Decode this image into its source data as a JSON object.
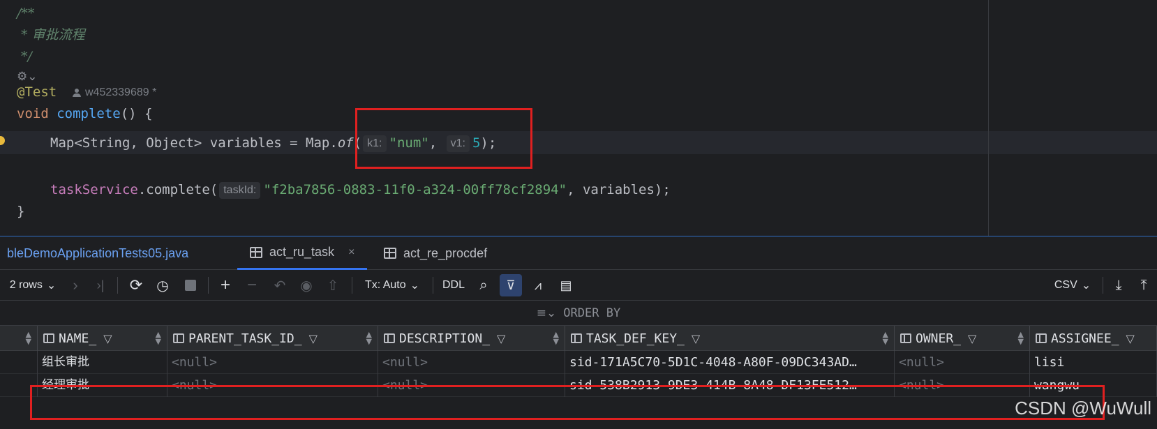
{
  "editor": {
    "comment_open": "/**",
    "comment_text": " * 审批流程",
    "comment_close": " */",
    "annotation": "@Test",
    "author": "w452339689 *",
    "method_kw": "void",
    "method_name": "complete",
    "method_tail": "() {",
    "line_map_prefix": "Map<String, Object> variables = Map.",
    "line_map_method": "of",
    "line_map_open": "(",
    "hint_k1": "k1:",
    "val_k1": "\"num\"",
    "comma": ", ",
    "hint_v1": "v1:",
    "val_v1": "5",
    "line_map_close": ");",
    "service_field": "taskService",
    "service_call": ".complete(",
    "hint_taskid": "taskId:",
    "task_id": "\"f2ba7856-0883-11f0-a324-00ff78cf2894\"",
    "service_tail": ", variables);",
    "close_brace": "}"
  },
  "tabs": [
    {
      "label": "bleDemoApplicationTests05.java"
    },
    {
      "label": "act_ru_task",
      "close": "×"
    },
    {
      "label": "act_re_procdef"
    }
  ],
  "toolbar": {
    "rows": "2 rows",
    "tx": "Tx: Auto",
    "ddl": "DDL",
    "csv": "CSV"
  },
  "order_by": "ORDER BY",
  "columns": [
    "NAME_",
    "PARENT_TASK_ID_",
    "DESCRIPTION_",
    "TASK_DEF_KEY_",
    "OWNER_",
    "ASSIGNEE_"
  ],
  "rows": [
    [
      "组长审批",
      "<null>",
      "<null>",
      "sid-171A5C70-5D1C-4048-A80F-09DC343AD…",
      "<null>",
      "lisi"
    ],
    [
      "经理审批",
      "<null>",
      "<null>",
      "sid-538B2913-9DE3-414B-8A48-DF13FE512…",
      "<null>",
      "wangwu"
    ]
  ],
  "watermark": "CSDN @WuWull"
}
